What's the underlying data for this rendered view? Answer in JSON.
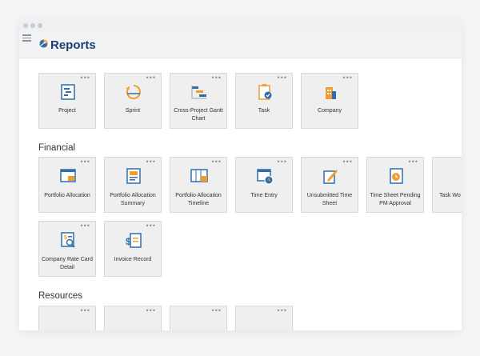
{
  "header": {
    "title": "Reports"
  },
  "general_tiles": [
    {
      "label": "Project",
      "icon": "project-gantt-icon"
    },
    {
      "label": "Sprint",
      "icon": "sprint-cycle-icon"
    },
    {
      "label": "Cross-Project Gantt Chart",
      "icon": "gantt-chart-icon"
    },
    {
      "label": "Task",
      "icon": "task-clipboard-icon"
    },
    {
      "label": "Company",
      "icon": "company-building-icon"
    }
  ],
  "financial": {
    "title": "Financial",
    "tiles": [
      {
        "label": "Portfolio Allocation",
        "icon": "portfolio-allocation-icon"
      },
      {
        "label": "Portfolio Allocation Summary",
        "icon": "allocation-summary-icon"
      },
      {
        "label": "Portfolio Allocation Timeline",
        "icon": "allocation-timeline-icon"
      },
      {
        "label": "Time Entry",
        "icon": "time-entry-icon"
      },
      {
        "label": "Unsubmitted Time Sheet",
        "icon": "unsubmitted-timesheet-icon"
      },
      {
        "label": "Time Sheet Pending PM Approval",
        "icon": "pending-approval-icon"
      },
      {
        "label": "Task Wo",
        "icon": "task-workload-icon"
      },
      {
        "label": "Company Rate Card Detail",
        "icon": "rate-card-icon"
      },
      {
        "label": "Invoice Record",
        "icon": "invoice-record-icon"
      }
    ]
  },
  "resources": {
    "title": "Resources"
  },
  "more_label": "•••",
  "colors": {
    "accent_blue": "#2f6ead",
    "accent_orange": "#f39c2e",
    "title_navy": "#1e3f6e"
  }
}
